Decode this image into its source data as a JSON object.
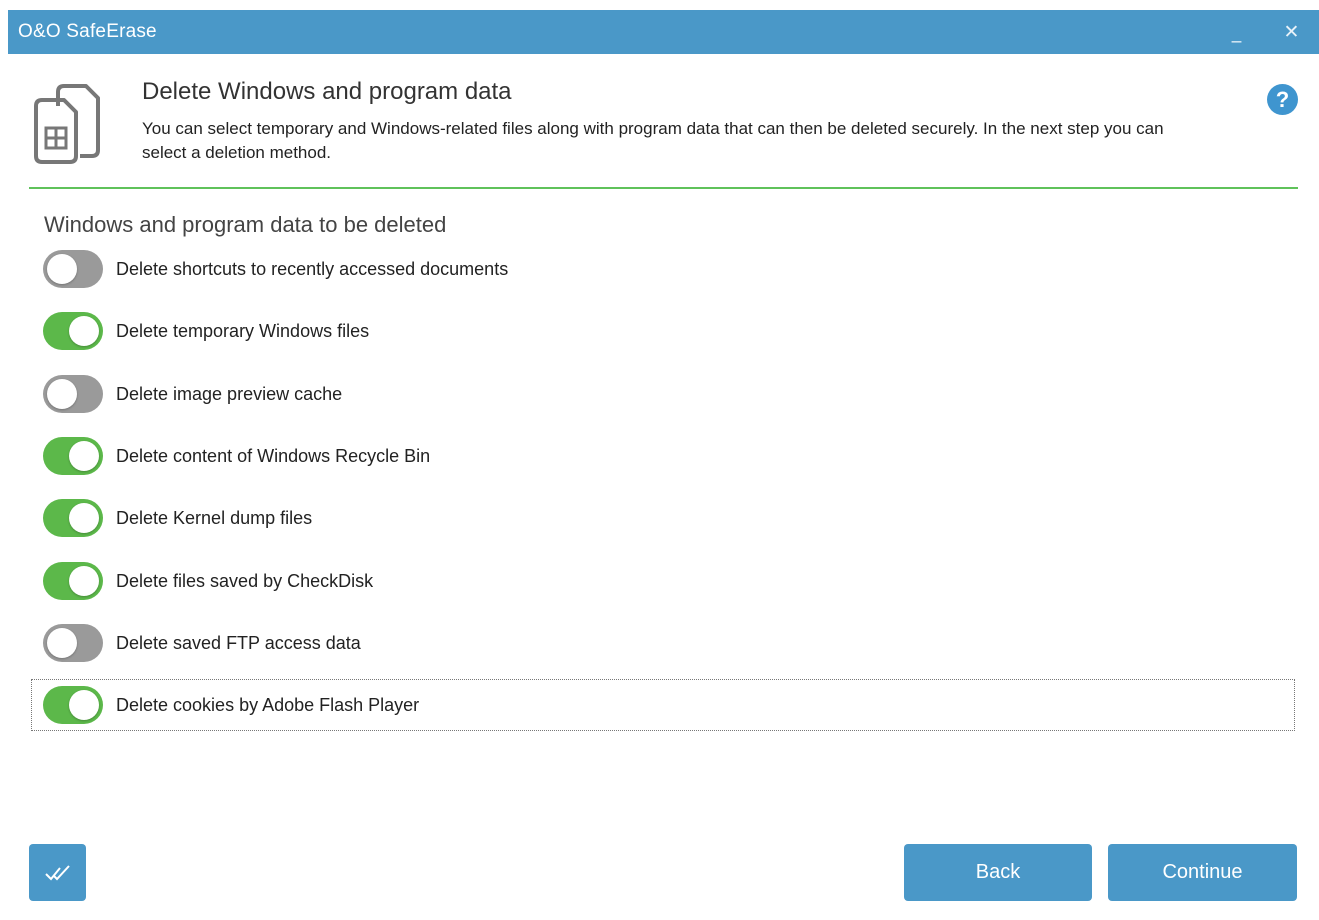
{
  "window": {
    "title": "O&O SafeErase",
    "minimize_glyph": "_",
    "close_glyph": "✕"
  },
  "header": {
    "icon": "windows-files-icon",
    "title": "Delete Windows and program data",
    "description": "You can select temporary and Windows-related files along with program data that can then be deleted securely. In the next step you can select a deletion method.",
    "help_glyph": "?"
  },
  "section": {
    "title": "Windows and program data to be deleted"
  },
  "options": [
    {
      "label": "Delete shortcuts to recently accessed documents",
      "enabled": false
    },
    {
      "label": "Delete temporary Windows files",
      "enabled": true
    },
    {
      "label": "Delete image preview cache",
      "enabled": false
    },
    {
      "label": "Delete content of Windows Recycle Bin",
      "enabled": true
    },
    {
      "label": "Delete Kernel dump files",
      "enabled": true
    },
    {
      "label": "Delete files saved by CheckDisk",
      "enabled": true
    },
    {
      "label": "Delete saved FTP access data",
      "enabled": false
    },
    {
      "label": "Delete cookies by Adobe Flash Player",
      "enabled": true,
      "focused": true
    }
  ],
  "footer": {
    "select_all_icon": "double-check-icon",
    "back_label": "Back",
    "continue_label": "Continue"
  },
  "colors": {
    "titlebar": "#4a98c8",
    "accent_green": "#5cb84a",
    "toggle_off": "#9a9a9a",
    "button": "#4a98c8",
    "divider": "#5fc25a"
  }
}
